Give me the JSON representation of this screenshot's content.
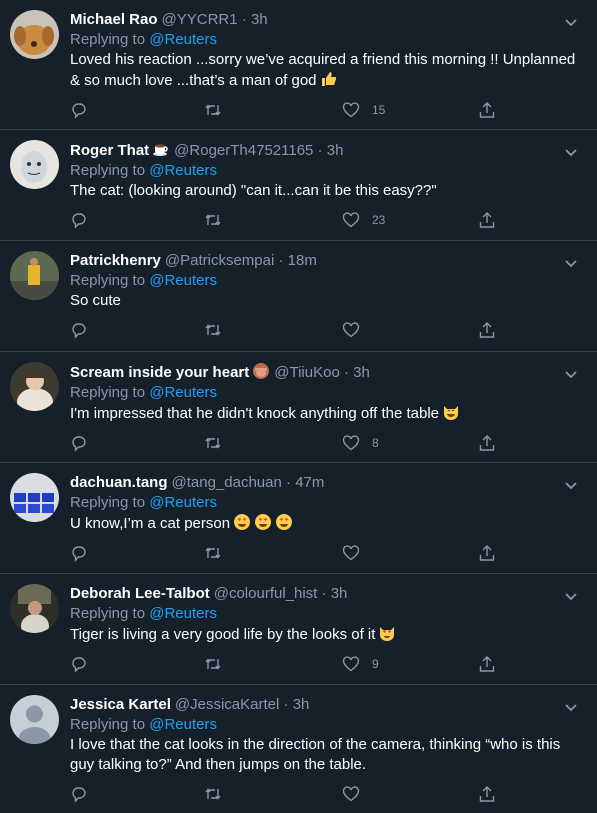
{
  "replying_label": "Replying to ",
  "tweets": [
    {
      "name": "Michael Rao",
      "handle": "@YYCRR1",
      "sep": " · ",
      "time": "3h",
      "mention": "@Reuters",
      "text": "Loved his reaction ...sorry we’ve acquired a friend this morning !! Unplanned & so much love  ...that’s a man of god",
      "trailing_emoji": "thumbs-up",
      "likes": "15",
      "avatar": "dog-photo"
    },
    {
      "name": "Roger That",
      "name_emoji": "coffee",
      "handle": "@RogerTh47521165",
      "sep": " · ",
      "time": "3h",
      "mention": "@Reuters",
      "text": "The cat: (looking around) \"can it...can it be this easy??\"",
      "likes": "23",
      "avatar": "cartoon-face"
    },
    {
      "name": "Patrickhenry",
      "handle": "@Patricksempai",
      "sep": " · ",
      "time": "18m",
      "mention": "@Reuters",
      "text": "So cute",
      "likes": "",
      "avatar": "street-photo"
    },
    {
      "name": "Scream inside your heart",
      "name_emoji": "monkey",
      "handle": "@TiiuKoo",
      "sep": " · ",
      "time": "3h",
      "mention": "@Reuters",
      "text": "I'm impressed that he didn't knock anything off the table",
      "trailing_emoji": "grinning-cat",
      "likes": "8",
      "avatar": "portrait-painting"
    },
    {
      "name": "dachuan.tang",
      "handle": "@tang_dachuan",
      "sep": " · ",
      "time": "47m",
      "mention": "@Reuters",
      "text": "U know,I’m a cat person",
      "trailing_emoji": "heart-eyes x3",
      "likes": "",
      "avatar": "blue-screens"
    },
    {
      "name": "Deborah Lee-Talbot",
      "handle": "@colourful_hist",
      "sep": " · ",
      "time": "3h",
      "mention": "@Reuters",
      "text": "Tiger is living a very good life by the looks of it",
      "trailing_emoji": "heart-eyes-cat",
      "likes": "9",
      "avatar": "person-photo"
    },
    {
      "name": "Jessica Kartel",
      "handle": "@JessicaKartel",
      "sep": " · ",
      "time": "3h",
      "mention": "@Reuters",
      "text": "I love that the cat looks in the direction of the camera, thinking “who is this guy talking to?” And then jumps on the table.",
      "likes": "",
      "avatar": "default-avatar"
    }
  ],
  "icons": {
    "reply": "reply-icon",
    "retweet": "retweet-icon",
    "like": "heart-icon",
    "share": "share-icon",
    "more": "chevron-down-icon"
  },
  "colors": {
    "background": "#15202b",
    "border": "#38444d",
    "muted": "#8899a6",
    "link": "#1da1f2"
  }
}
